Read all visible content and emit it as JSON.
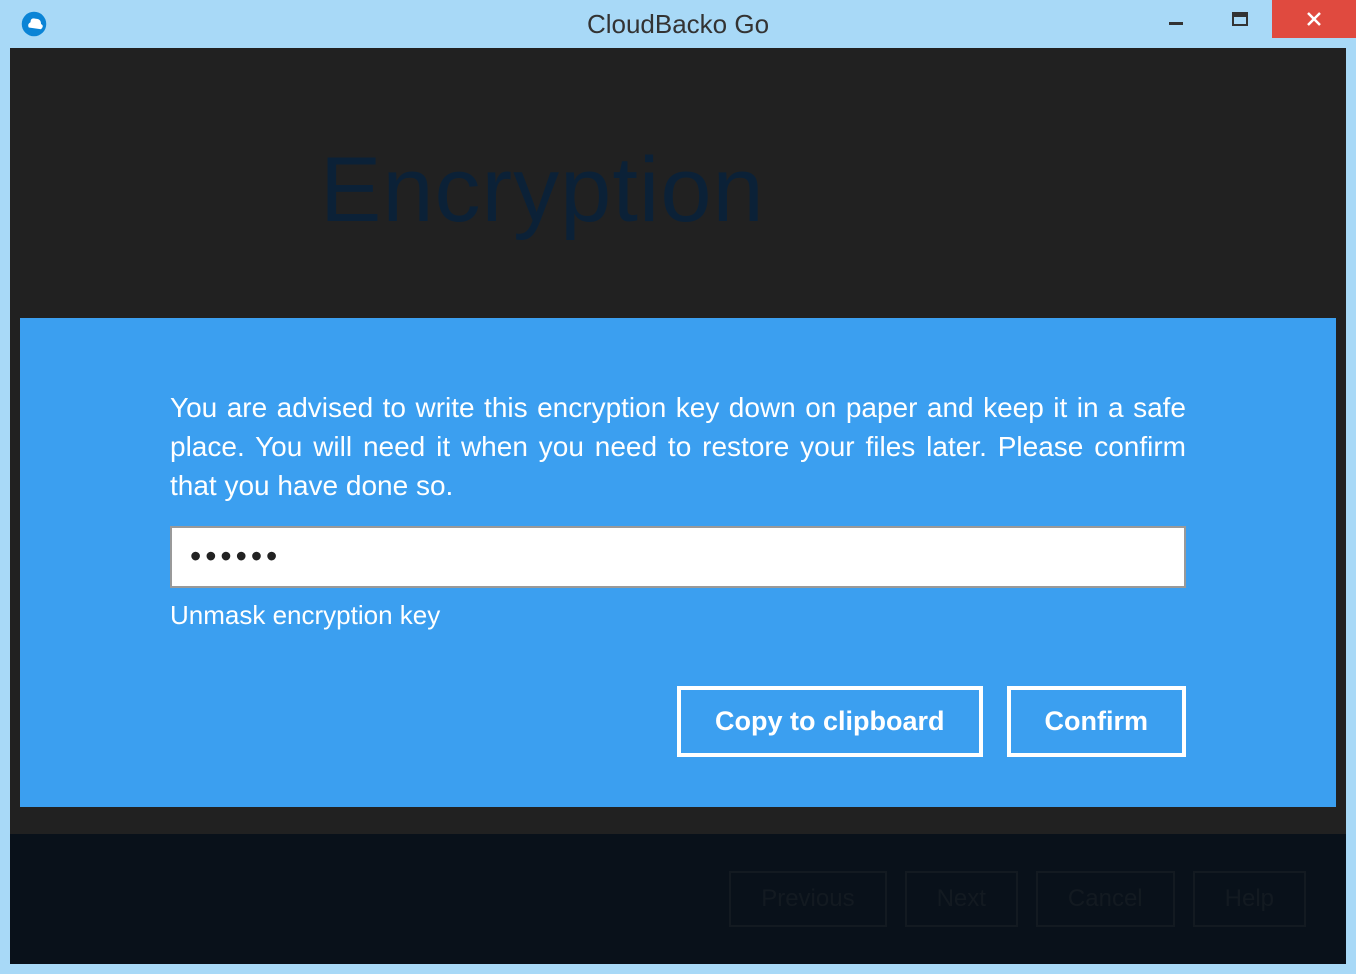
{
  "window": {
    "title": "CloudBacko Go"
  },
  "page": {
    "heading": "Encryption"
  },
  "modal": {
    "message": "You are advised to write this encryption key down on paper and keep it in a safe place. You will need it when you need to restore your files later. Please confirm that you have done so.",
    "key_value": "••••••",
    "unmask_label": "Unmask encryption key",
    "copy_label": "Copy to clipboard",
    "confirm_label": "Confirm"
  },
  "footer": {
    "previous": "Previous",
    "next": "Next",
    "cancel": "Cancel",
    "help": "Help"
  }
}
